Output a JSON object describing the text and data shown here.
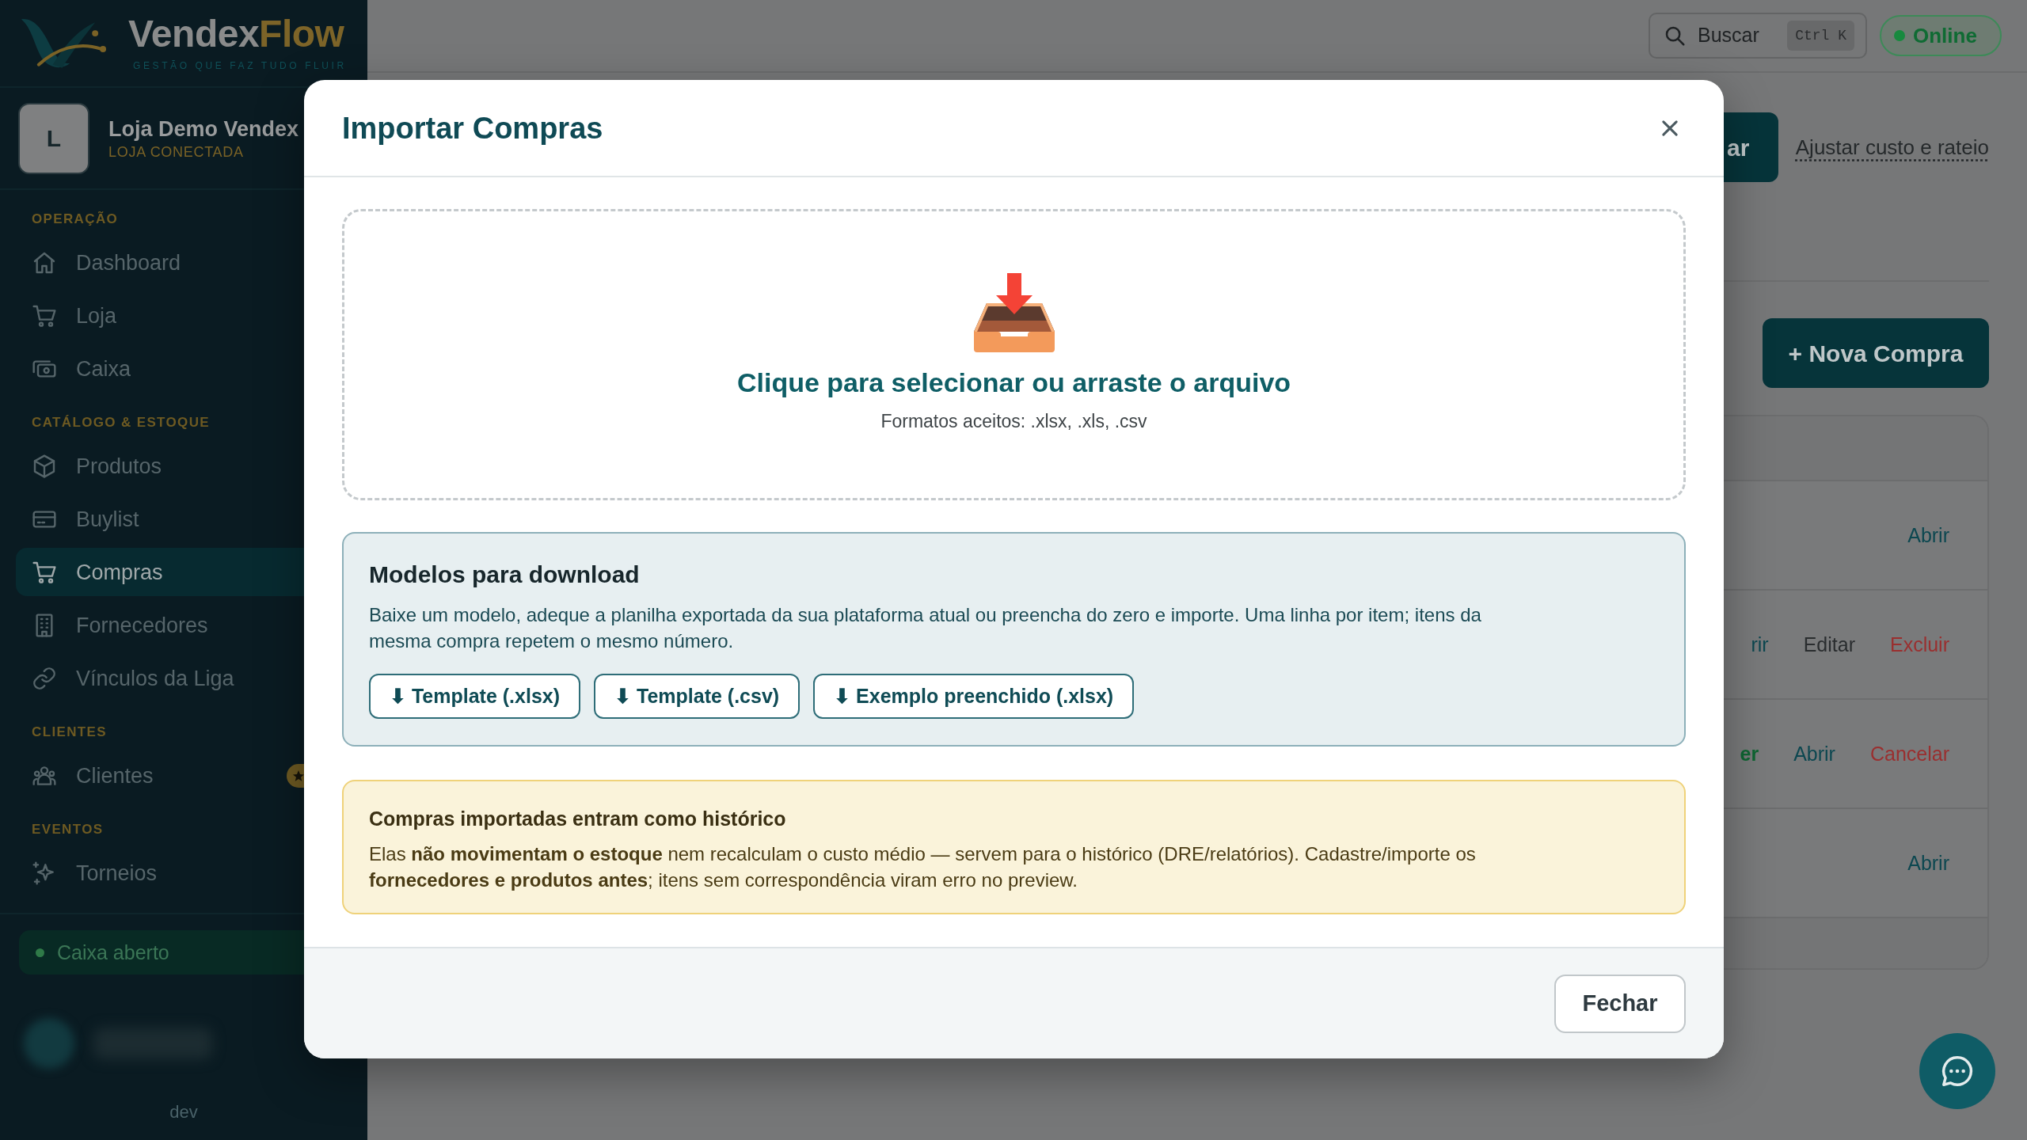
{
  "sidebar": {
    "logo": {
      "word_1": "Vendex",
      "word_2": "Flow",
      "tagline": "GESTÃO QUE FAZ TUDO FLUIR"
    },
    "store": {
      "avatar_letter": "L",
      "name": "Loja Demo Vendex",
      "status": "LOJA CONECTADA"
    },
    "sections": [
      {
        "title": "OPERAÇÃO",
        "items": [
          {
            "label": "Dashboard",
            "selected": false,
            "badge": false
          },
          {
            "label": "Loja",
            "selected": false,
            "badge": false
          },
          {
            "label": "Caixa",
            "selected": false,
            "badge": false
          }
        ]
      },
      {
        "title": "CATÁLOGO & ESTOQUE",
        "items": [
          {
            "label": "Produtos",
            "selected": false,
            "badge": false
          },
          {
            "label": "Buylist",
            "selected": false,
            "badge": false
          },
          {
            "label": "Compras",
            "selected": true,
            "badge": false
          },
          {
            "label": "Fornecedores",
            "selected": false,
            "badge": false
          },
          {
            "label": "Vínculos da Liga",
            "selected": false,
            "badge": false
          }
        ]
      },
      {
        "title": "CLIENTES",
        "items": [
          {
            "label": "Clientes",
            "selected": false,
            "badge": true
          }
        ]
      },
      {
        "title": "EVENTOS",
        "items": [
          {
            "label": "Torneios",
            "selected": false,
            "badge": false
          }
        ]
      }
    ],
    "cash_status": {
      "label": "Caixa aberto"
    },
    "footer_text": "dev"
  },
  "topbar": {
    "search": {
      "label": "Buscar",
      "shortcut": "Ctrl K"
    },
    "status": {
      "label": "Online"
    }
  },
  "page": {
    "header_button": "ar",
    "header_link": "Ajustar custo e rateio",
    "new_button": "+ Nova Compra",
    "table": {
      "rows": [
        {
          "actions": [
            {
              "label": "Abrir",
              "kind": "primary"
            }
          ]
        },
        {
          "actions": [
            {
              "label": "rir",
              "kind": "primary"
            },
            {
              "label": "Editar",
              "kind": "neutral"
            },
            {
              "label": "Excluir",
              "kind": "danger"
            }
          ]
        },
        {
          "actions": [
            {
              "label": "er",
              "kind": "success"
            },
            {
              "label": "Abrir",
              "kind": "primary"
            },
            {
              "label": "Cancelar",
              "kind": "danger"
            }
          ]
        },
        {
          "actions": [
            {
              "label": "Abrir",
              "kind": "primary"
            }
          ]
        }
      ]
    }
  },
  "modal": {
    "title": "Importar Compras",
    "dropzone": {
      "title": "Clique para selecionar ou arraste o arquivo",
      "hint": "Formatos aceitos: .xlsx, .xls, .csv"
    },
    "templates": {
      "title": "Modelos para download",
      "text": "Baixe um modelo, adeque a planilha exportada da sua plataforma atual ou preencha do zero e importe. Uma linha por item; itens da mesma compra repetem o mesmo número.",
      "buttons": [
        "⬇ Template (.xlsx)",
        "⬇ Template (.csv)",
        "⬇ Exemplo preenchido (.xlsx)"
      ]
    },
    "notice": {
      "title": "Compras importadas entram como histórico",
      "text": "Elas **não movimentam o estoque** nem recalculam o custo médio — servem para o histórico (DRE/relatórios). Cadastre/importe os **fornecedores e produtos antes**; itens sem correspondência viram erro no preview."
    },
    "close_button": "Fechar"
  }
}
